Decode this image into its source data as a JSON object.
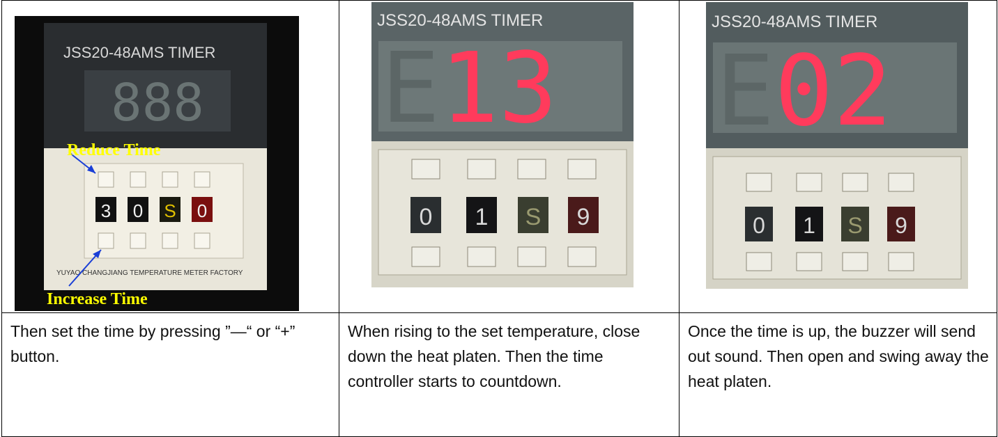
{
  "panels": [
    {
      "brand": "JSS20-48AMS   TIMER",
      "display": "888",
      "wheels": [
        "3",
        "0",
        "S",
        "0"
      ],
      "factory": "YUYAO CHANGJIANG TEMPERATURE METER FACTORY",
      "label_top": "Reduce Time",
      "label_bottom": "Increase Time",
      "caption": "Then set the time by pressing ”—“ or “+” button."
    },
    {
      "brand": "JSS20-48AMS  TIMER",
      "display": "E13",
      "wheels": [
        "0",
        "1",
        "S",
        "9"
      ],
      "caption": "When rising to the set temperature, close down the heat platen. Then the time controller starts to countdown."
    },
    {
      "brand": "JSS20-48AMS  TIMER",
      "display": "E02",
      "wheels": [
        "0",
        "1",
        "S",
        "9"
      ],
      "caption": "Once the time is up, the buzzer will send out sound. Then open and swing away the heat platen."
    }
  ],
  "colors": {
    "led_on": "#ff3b5c",
    "led_off": "#5c6666",
    "label": "#ffff00",
    "arrow": "#1a3fd6"
  }
}
